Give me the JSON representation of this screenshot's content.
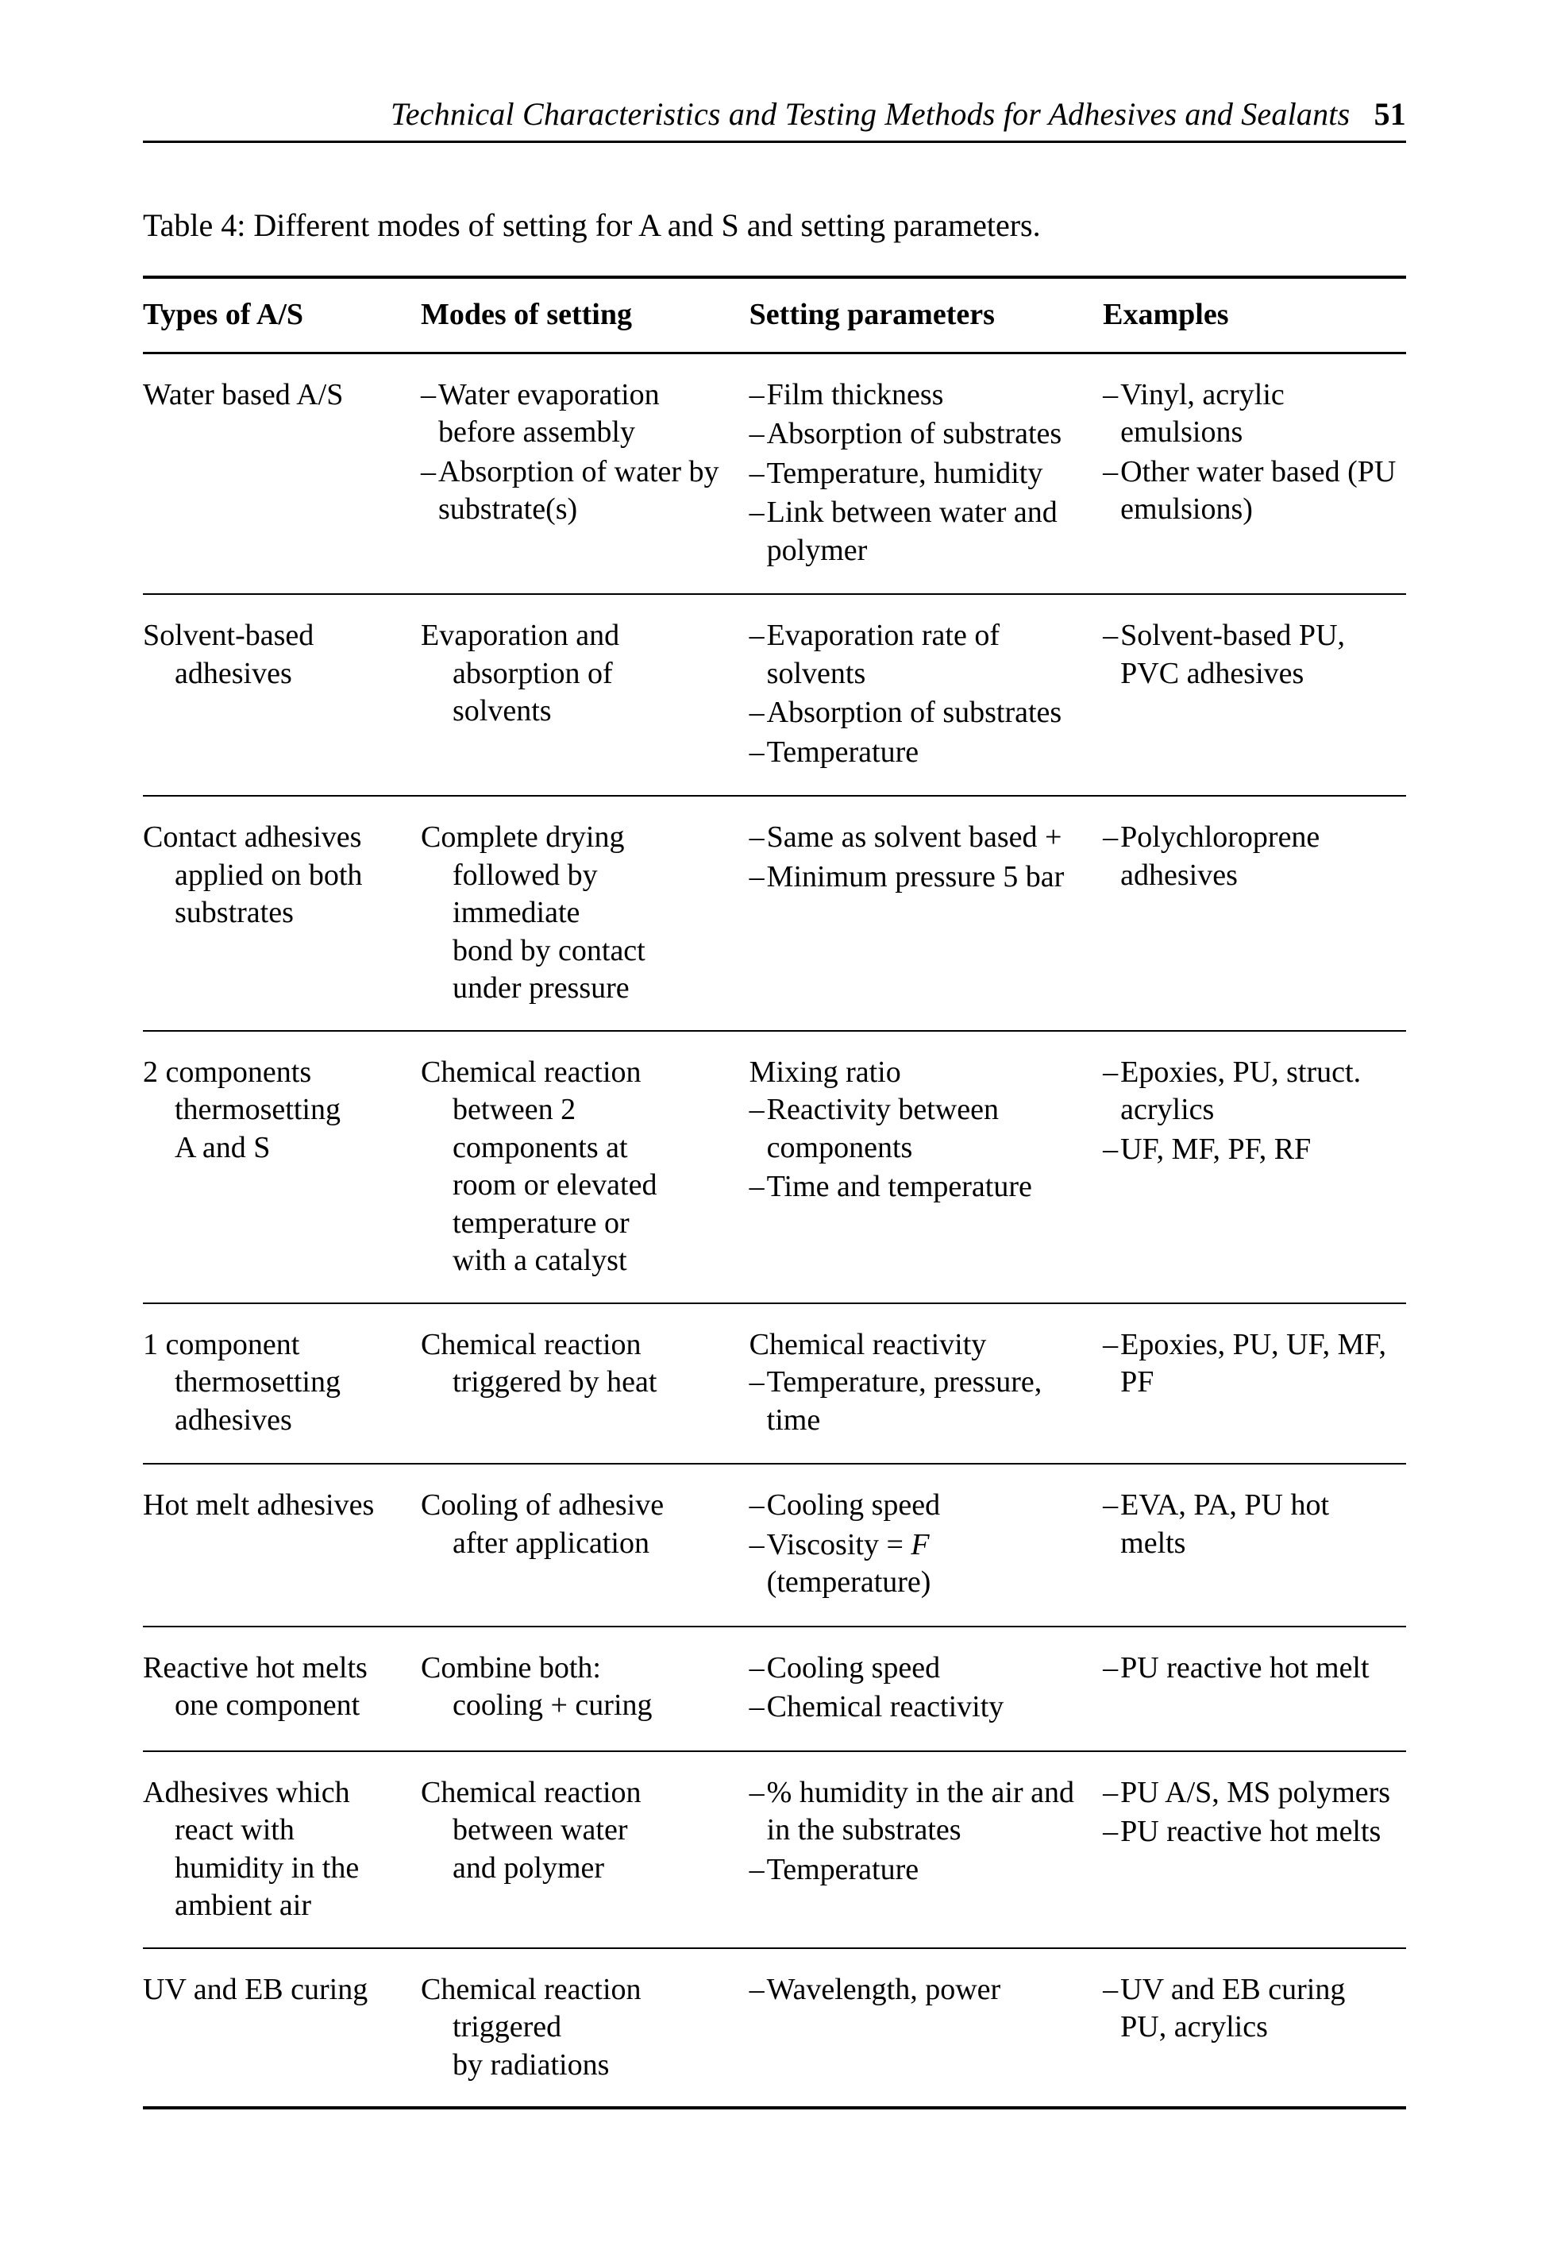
{
  "header": {
    "title": "Technical Characteristics and Testing Methods for Adhesives and Sealants",
    "page_number": "51"
  },
  "table": {
    "caption": "Table 4:  Different modes of setting for A and S and setting parameters.",
    "columns": {
      "types": "Types of A/S",
      "modes": "Modes of setting",
      "params": "Setting parameters",
      "examples": "Examples"
    },
    "rows": [
      {
        "type_lines": [
          "Water based A/S"
        ],
        "modes_bullets": [
          "Water evaporation before assembly",
          "Absorption of water by substrate(s)"
        ],
        "params_bullets": [
          "Film thickness",
          "Absorption of substrates",
          "Temperature, humidity",
          "Link between water and polymer"
        ],
        "examples_bullets": [
          "Vinyl, acrylic emulsions",
          "Other water based (PU emulsions)"
        ]
      },
      {
        "type_lines": [
          "Solvent-based",
          "adhesives"
        ],
        "modes_plain_lines": [
          "Evaporation and",
          "absorption of",
          "solvents"
        ],
        "params_bullets": [
          "Evaporation rate of solvents",
          "Absorption of substrates",
          "Temperature"
        ],
        "examples_bullets": [
          "Solvent-based PU, PVC adhesives"
        ]
      },
      {
        "type_lines": [
          "Contact adhesives",
          "applied on both",
          "substrates"
        ],
        "modes_plain_lines": [
          "Complete drying",
          "followed by",
          "immediate",
          "bond by contact",
          "under pressure"
        ],
        "params_bullets": [
          "Same as solvent based +",
          "Minimum pressure 5 bar"
        ],
        "examples_bullets": [
          "Polychloroprene adhesives"
        ]
      },
      {
        "type_lines": [
          "2 components",
          "thermosetting",
          "A and S"
        ],
        "modes_plain_lines": [
          "Chemical reaction",
          "between 2",
          "components at",
          "room or elevated",
          "temperature or",
          "with a catalyst"
        ],
        "params_top_line": "Mixing ratio",
        "params_bullets": [
          "Reactivity between components",
          "Time and temperature"
        ],
        "examples_bullets": [
          "Epoxies, PU, struct. acrylics",
          "UF, MF, PF, RF"
        ]
      },
      {
        "type_lines": [
          "1 component",
          "thermosetting",
          "adhesives"
        ],
        "modes_plain_lines": [
          "Chemical reaction",
          "triggered by heat"
        ],
        "params_top_line": "Chemical reactivity",
        "params_bullets": [
          "Temperature, pressure, time"
        ],
        "examples_bullets": [
          "Epoxies, PU, UF, MF, PF"
        ]
      },
      {
        "type_lines": [
          "Hot melt adhesives"
        ],
        "modes_plain_lines": [
          "Cooling of adhesive",
          "after application"
        ],
        "params_bullets_html": [
          "Cooling speed",
          "Viscosity = <span class=\"ital\">F</span> (temperature)"
        ],
        "examples_bullets": [
          "EVA, PA, PU hot melts"
        ]
      },
      {
        "type_lines": [
          "Reactive hot melts",
          "one component"
        ],
        "modes_plain_lines": [
          "Combine both:",
          "cooling + curing"
        ],
        "params_bullets": [
          "Cooling speed",
          "Chemical reactivity"
        ],
        "examples_bullets": [
          "PU reactive hot melt"
        ]
      },
      {
        "type_lines": [
          "Adhesives which",
          "react with",
          "humidity in the",
          "ambient air"
        ],
        "modes_plain_lines": [
          "Chemical reaction",
          "between water",
          "and polymer"
        ],
        "params_bullets": [
          "% humidity in the air and in the substrates",
          "Temperature"
        ],
        "examples_bullets": [
          "PU A/S, MS polymers",
          "PU reactive hot melts"
        ]
      },
      {
        "type_lines": [
          "UV and EB curing"
        ],
        "modes_plain_lines": [
          "Chemical reaction",
          "triggered",
          "by radiations"
        ],
        "params_bullets": [
          "Wavelength, power"
        ],
        "examples_bullets": [
          "UV and EB curing PU, acrylics"
        ]
      }
    ]
  }
}
